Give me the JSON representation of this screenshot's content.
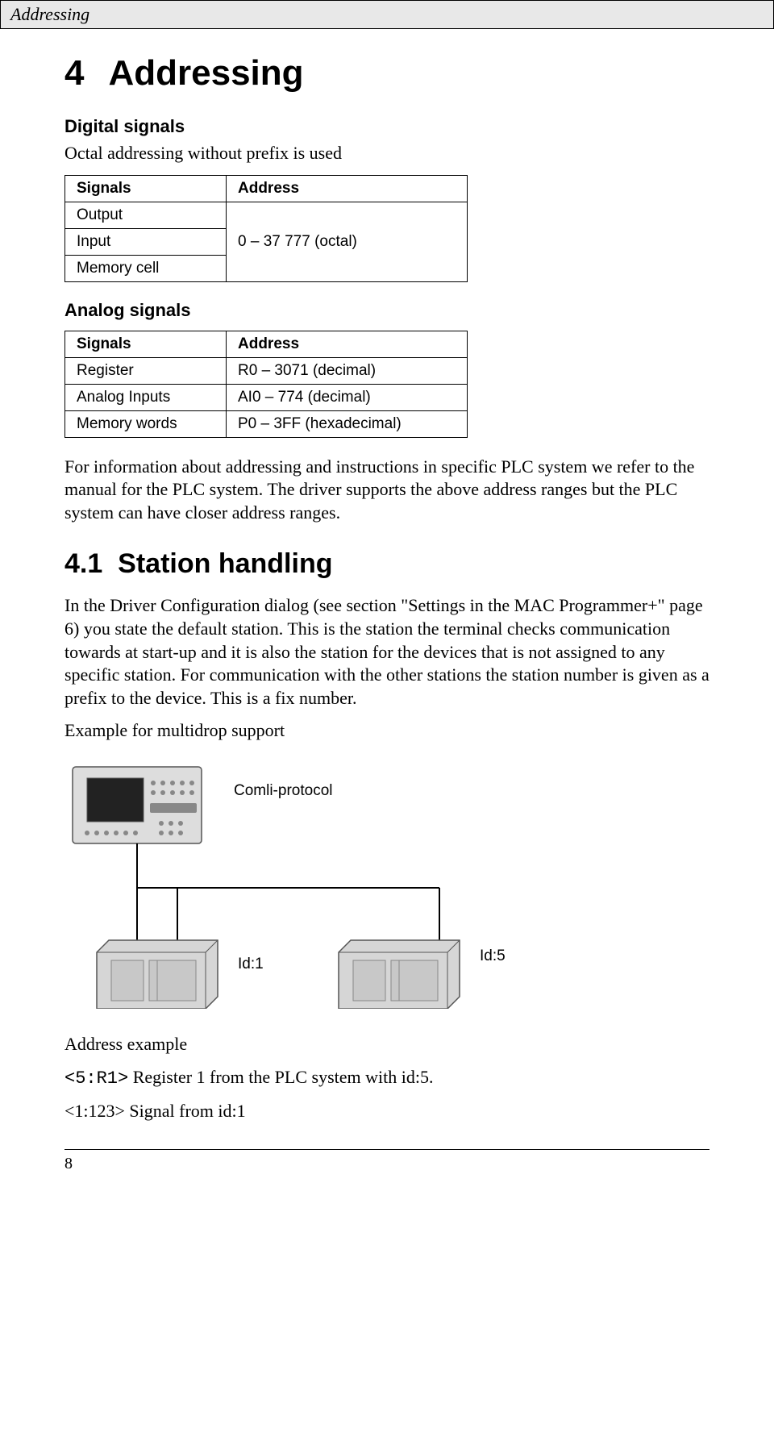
{
  "header": {
    "title": "Addressing"
  },
  "chapter": {
    "number": "4",
    "title": "Addressing"
  },
  "digital": {
    "heading": "Digital signals",
    "intro": "Octal addressing without prefix is used",
    "table": {
      "col1": "Signals",
      "col2": "Address",
      "rows": [
        {
          "signal": "Output",
          "address": "0 – 37 777 (octal)"
        },
        {
          "signal": "Input",
          "address": ""
        },
        {
          "signal": "Memory cell",
          "address": ""
        }
      ]
    }
  },
  "analog": {
    "heading": "Analog signals",
    "table": {
      "col1": "Signals",
      "col2": "Address",
      "rows": [
        {
          "signal": "Register",
          "address": "R0 – 3071 (decimal)"
        },
        {
          "signal": "Analog Inputs",
          "address": "AI0 – 774 (decimal)"
        },
        {
          "signal": "Memory words",
          "address": "P0 – 3FF (hexadecimal)"
        }
      ]
    }
  },
  "para1": "For information about addressing and instructions in specific PLC system we refer to the manual for the PLC system. The driver supports the above address ranges but the PLC system can have closer address ranges.",
  "section41": {
    "number": "4.1",
    "title": "Station handling"
  },
  "para2": "In the Driver Configuration dialog (see section \"Settings in the MAC Programmer+\" page 6) you state the default station. This is the station the terminal checks communication towards at start-up and it is also the station for the devices that is not assigned to any specific station. For communication with the other stations the station number is given as a prefix to the device. This is a fix number.",
  "para3": "Example for multidrop support",
  "diagram": {
    "protocol": "Comli-protocol",
    "id1": "Id:1",
    "id5": "Id:5"
  },
  "example": {
    "heading": "Address example",
    "line1_code": "<5:R1>",
    "line1_text": " Register 1 from the PLC system with id:5.",
    "line2": "<1:123> Signal from id:1"
  },
  "pagenum": "8"
}
